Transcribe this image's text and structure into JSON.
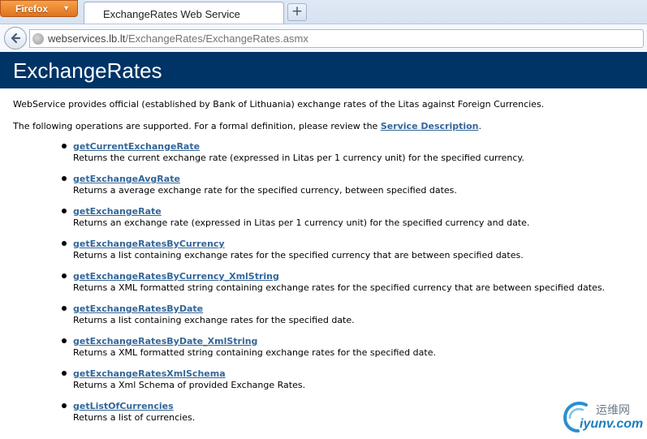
{
  "browser": {
    "menu_button": "Firefox",
    "tab_title": "ExchangeRates Web Service",
    "new_tab_label": "+",
    "url_host": "webservices.lb.lt",
    "url_path": "/ExchangeRates/ExchangeRates.asmx",
    "accent": "#e0731d"
  },
  "page": {
    "title": "ExchangeRates",
    "header_color": "#003366",
    "intro_text": "WebService provides official (established by Bank of Lithuania) exchange rates of the Litas against Foreign Currencies.",
    "ops_intro_prefix": "The following operations are supported. For a formal definition, please review the ",
    "service_description_link": "Service Description",
    "ops_intro_suffix": ".",
    "link_color": "#336699",
    "operations": [
      {
        "name": "getCurrentExchangeRate",
        "description": "Returns the current exchange rate (expressed in Litas per 1 currency unit) for the specified currency."
      },
      {
        "name": "getExchangeAvgRate",
        "description": "Returns a average exchange rate for the specified currency, between specified dates."
      },
      {
        "name": "getExchangeRate",
        "description": "Returns an exchange rate (expressed in Litas per 1 currency unit) for the specified currency and date."
      },
      {
        "name": "getExchangeRatesByCurrency",
        "description": "Returns a list containing exchange rates for the specified currency that are between specified dates."
      },
      {
        "name": "getExchangeRatesByCurrency_XmlString",
        "description": "Returns a XML formatted string containing exchange rates for the specified currency that are between specified dates."
      },
      {
        "name": "getExchangeRatesByDate",
        "description": "Returns a list containing exchange rates for the specified date."
      },
      {
        "name": "getExchangeRatesByDate_XmlString",
        "description": "Returns a XML formatted string containing exchange rates for the specified date."
      },
      {
        "name": "getExchangeRatesXmlSchema",
        "description": "Returns a Xml Schema of provided Exchange Rates."
      },
      {
        "name": "getListOfCurrencies",
        "description": "Returns a list of currencies."
      }
    ]
  },
  "watermark": {
    "chinese": "运维网",
    "site": "iyunv.com"
  }
}
